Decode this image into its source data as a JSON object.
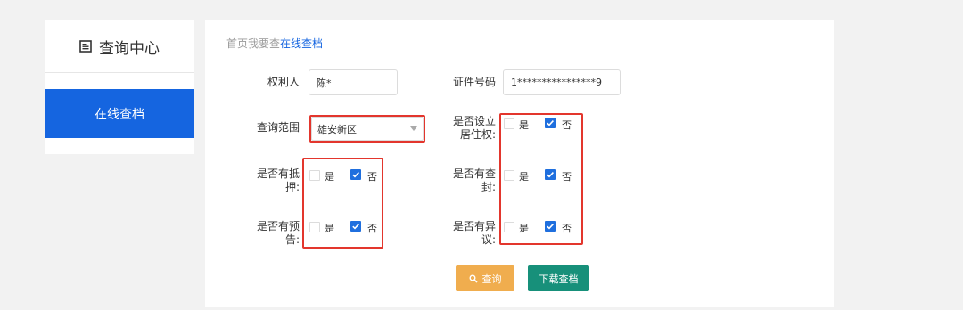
{
  "sidebar": {
    "title": "查询中心",
    "items": [
      {
        "label": "在线查档",
        "active": true
      }
    ]
  },
  "breadcrumb": {
    "home": "首页",
    "middle": "我要查",
    "current": "在线查档"
  },
  "form": {
    "owner": {
      "label": "权利人",
      "value": "陈*"
    },
    "id_number": {
      "label": "证件号码",
      "value": "1****************9"
    },
    "scope": {
      "label": "查询范围",
      "selected": "雄安新区"
    },
    "residence": {
      "label_line1": "是否设立",
      "label_line2": "居住权:",
      "yes": "是",
      "no": "否",
      "value": "否"
    },
    "mortgage": {
      "label_line1": "是否有抵",
      "label_line2": "押:",
      "yes": "是",
      "no": "否",
      "value": "否"
    },
    "seizure": {
      "label_line1": "是否有查",
      "label_line2": "封:",
      "yes": "是",
      "no": "否",
      "value": "否"
    },
    "notice": {
      "label_line1": "是否有预",
      "label_line2": "告:",
      "yes": "是",
      "no": "否",
      "value": "否"
    },
    "objection": {
      "label_line1": "是否有异",
      "label_line2": "议:",
      "yes": "是",
      "no": "否",
      "value": "否"
    }
  },
  "buttons": {
    "query": "查询",
    "download": "下载查档"
  },
  "colors": {
    "primary": "#1565e0",
    "highlight_border": "#e3362d",
    "query_button": "#f0ad4e",
    "download_button": "#17907a"
  }
}
